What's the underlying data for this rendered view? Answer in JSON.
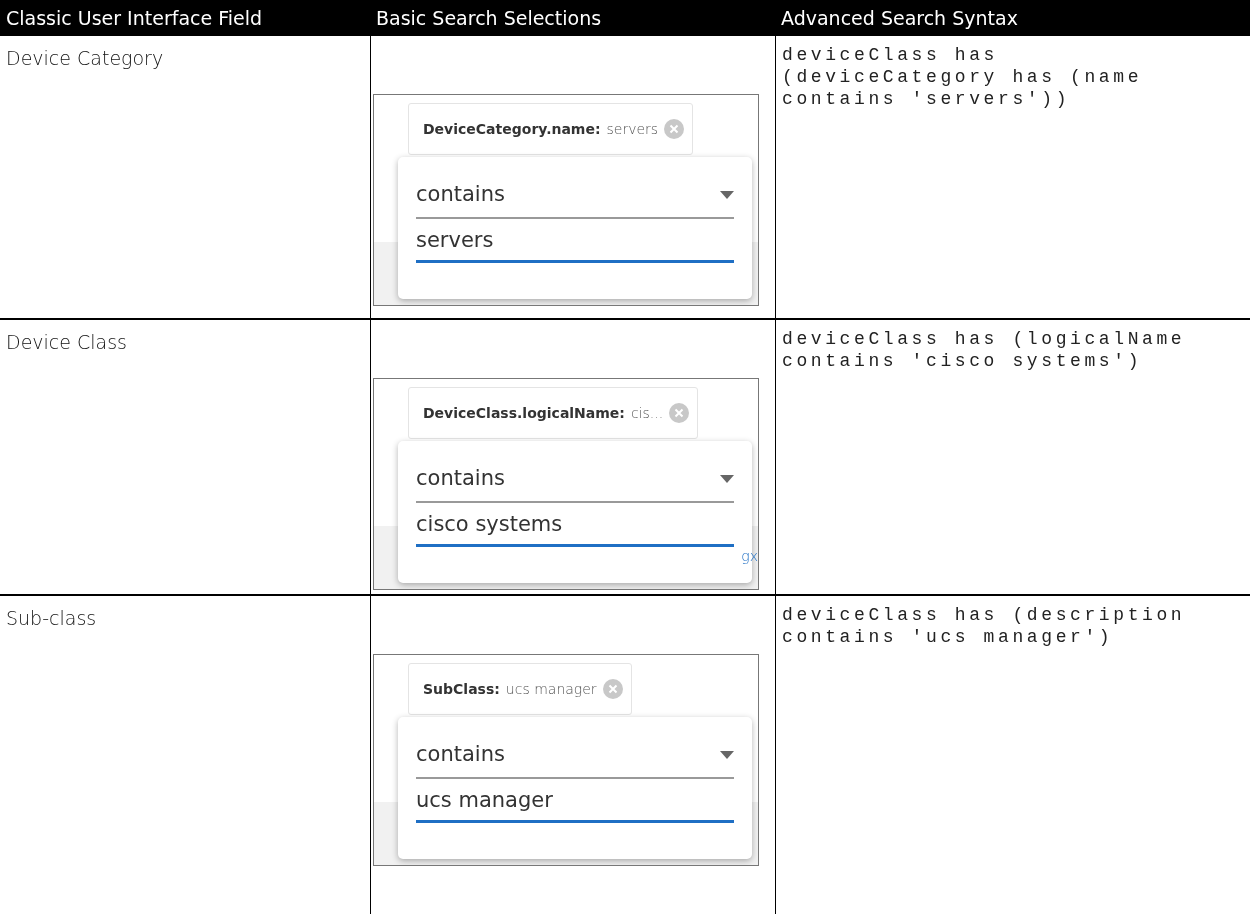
{
  "table": {
    "columns": [
      "Classic User Interface Field",
      "Basic Search Selections",
      "Advanced Search Syntax"
    ],
    "rows": [
      {
        "field": "Device Category",
        "selection": {
          "chip_key": "DeviceCategory.name:",
          "chip_value": "servers",
          "operator": "contains",
          "value": "servers"
        },
        "syntax": "deviceClass has (deviceCategory has (name contains 'servers'))"
      },
      {
        "field": "Device Class",
        "selection": {
          "chip_key": "DeviceClass.logicalName:",
          "chip_value": "cis...",
          "operator": "contains",
          "value": "cisco systems",
          "edge_text": "gx"
        },
        "syntax": "deviceClass has (logicalName contains 'cisco systems')"
      },
      {
        "field": "Sub-class",
        "selection": {
          "chip_key": "SubClass:",
          "chip_value": "ucs manager",
          "operator": "contains",
          "value": "ucs manager"
        },
        "syntax": "deviceClass has (description contains 'ucs manager')"
      }
    ]
  }
}
